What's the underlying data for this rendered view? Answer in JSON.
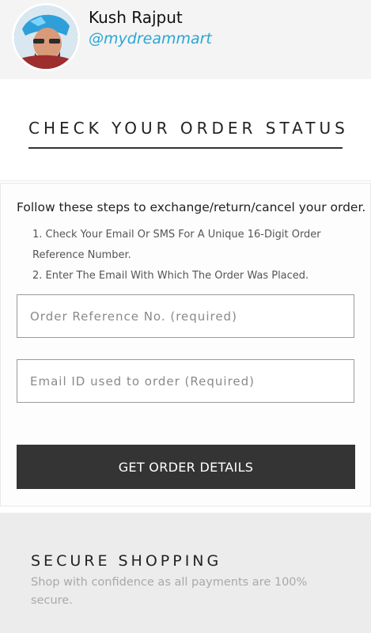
{
  "profile": {
    "name": "Kush Rajput",
    "handle": "@mydreammart"
  },
  "page": {
    "title": "CHECK YOUR ORDER STATUS"
  },
  "form": {
    "heading": "Follow these steps to exchange/return/cancel your order.",
    "steps": [
      "1. Check Your Email Or SMS For A Unique 16-Digit Order Reference Number.",
      "2. Enter The Email With Which The Order Was Placed."
    ],
    "order_ref_placeholder": "Order Reference No. (required)",
    "email_placeholder": "Email ID used to order (Required)",
    "submit_label": "GET ORDER DETAILS"
  },
  "secure": {
    "title": "SECURE SHOPPING",
    "text": "Shop with confidence as all payments are 100% secure."
  },
  "colors": {
    "handle": "#2aa6d8",
    "button_bg": "#343434",
    "secure_bg": "#ececec"
  }
}
